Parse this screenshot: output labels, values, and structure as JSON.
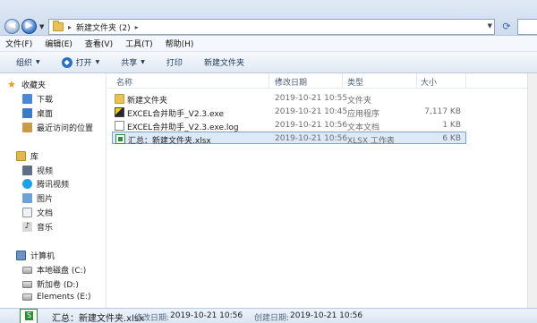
{
  "address": {
    "path": [
      "新建文件夹 (2)"
    ],
    "separator": "▸"
  },
  "menu": [
    "文件(F)",
    "编辑(E)",
    "查看(V)",
    "工具(T)",
    "帮助(H)"
  ],
  "toolbar": {
    "organize": "组织",
    "open": "打开",
    "share": "共享",
    "print": "打印",
    "new_folder": "新建文件夹"
  },
  "nav": {
    "favorites": "收藏夹",
    "downloads": "下载",
    "desktop": "桌面",
    "recent": "最近访问的位置",
    "libraries": "库",
    "videos": "视频",
    "tencent_video": "腾讯视频",
    "pictures": "图片",
    "documents": "文档",
    "music": "音乐",
    "computer": "计算机",
    "local_disk": "本地磁盘 (C:)",
    "new_volume": "新加卷 (D:)",
    "elements": "Elements (E:)"
  },
  "columns": {
    "name": "名称",
    "date": "修改日期",
    "type": "类型",
    "size": "大小"
  },
  "files": [
    {
      "name": "新建文件夹",
      "date": "2019-10-21 10:55",
      "type": "文件夹",
      "size": "",
      "icon": "folder-icon"
    },
    {
      "name": "EXCEL合并助手_V2.3.exe",
      "date": "2019-10-21 10:45",
      "type": "应用程序",
      "size": "7,117 KB",
      "icon": "exe-icon"
    },
    {
      "name": "EXCEL合并助手_V2.3.exe.log",
      "date": "2019-10-21 10:56",
      "type": "文本文档",
      "size": "1 KB",
      "icon": "log-file-icon"
    },
    {
      "name": "汇总：新建文件夹.xlsx",
      "date": "2019-10-21 10:56",
      "type": "XLSX 工作表",
      "size": "6 KB",
      "icon": "xlsx-icon"
    }
  ],
  "details": {
    "filename": "汇总：新建文件夹.xlsx",
    "modified_label": "修改日期:",
    "modified": "2019-10-21 10:56",
    "created_label": "创建日期:",
    "created": "2019-10-21 10:56"
  }
}
